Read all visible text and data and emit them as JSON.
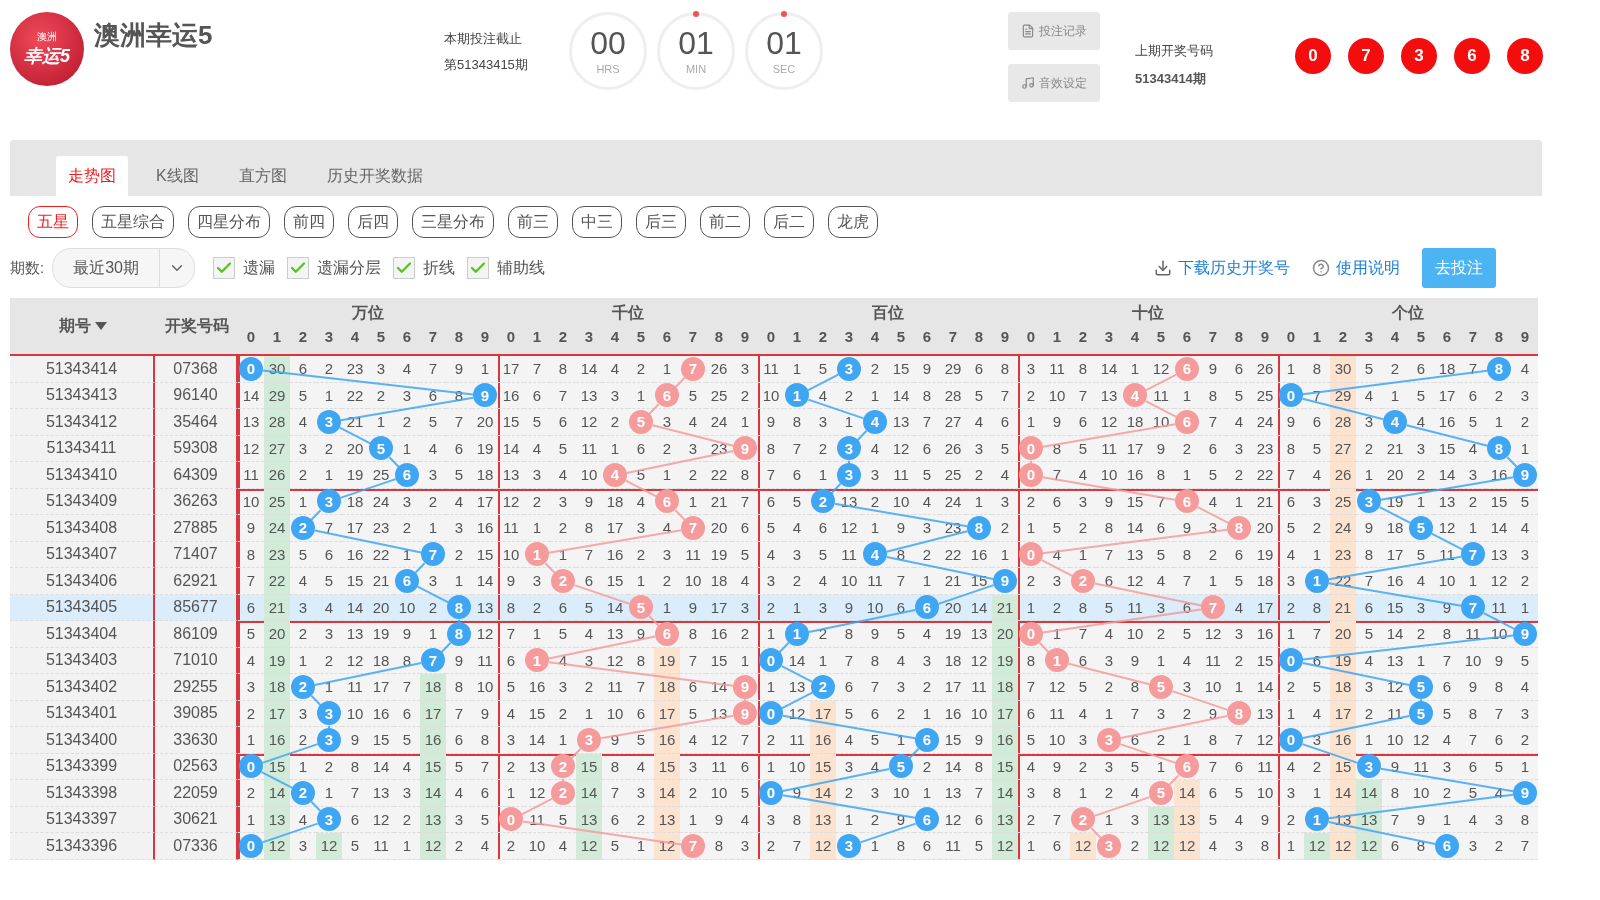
{
  "header": {
    "logo_text": [
      "澳洲",
      "幸运5"
    ],
    "title": "澳洲幸运5",
    "deadline_label": "本期投注截止",
    "deadline_period": "第51343415期",
    "countdown": [
      {
        "value": "00",
        "unit": "HRS",
        "dot": false
      },
      {
        "value": "01",
        "unit": "MIN",
        "dot": true
      },
      {
        "value": "01",
        "unit": "SEC",
        "dot": true
      }
    ],
    "buttons": [
      {
        "label": "投注记录",
        "kind": "record"
      },
      {
        "label": "音效设定",
        "kind": "sound"
      }
    ],
    "last_label": "上期开奖号码",
    "last_period": "51343414期",
    "last_balls": [
      "0",
      "7",
      "3",
      "6",
      "8"
    ]
  },
  "tabs": [
    {
      "label": "走势图",
      "selected": true
    },
    {
      "label": "K线图",
      "selected": false
    },
    {
      "label": "直方图",
      "selected": false
    },
    {
      "label": "历史开奖数据",
      "selected": false
    }
  ],
  "subtabs": [
    {
      "label": "五星",
      "selected": true
    },
    {
      "label": "五星综合",
      "selected": false
    },
    {
      "label": "四星分布",
      "selected": false
    },
    {
      "label": "前四",
      "selected": false
    },
    {
      "label": "后四",
      "selected": false
    },
    {
      "label": "三星分布",
      "selected": false
    },
    {
      "label": "前三",
      "selected": false
    },
    {
      "label": "中三",
      "selected": false
    },
    {
      "label": "后三",
      "selected": false
    },
    {
      "label": "前二",
      "selected": false
    },
    {
      "label": "后二",
      "selected": false
    },
    {
      "label": "龙虎",
      "selected": false
    }
  ],
  "filters": {
    "period_label": "期数:",
    "period_select": "最近30期",
    "options": [
      {
        "label": "遗漏",
        "checked": true
      },
      {
        "label": "遗漏分层",
        "checked": true
      },
      {
        "label": "折线",
        "checked": true
      },
      {
        "label": "辅助线",
        "checked": true
      }
    ],
    "download_link": "下载历史开奖号",
    "help_link": "使用说明",
    "bet_button": "去投注"
  },
  "table": {
    "period_header": "期号",
    "number_header": "开奖号码",
    "groups": [
      {
        "name": "万位",
        "color": "#3ea6f3",
        "digits": [
          "0",
          "1",
          "2",
          "3",
          "4",
          "5",
          "6",
          "7",
          "8",
          "9"
        ]
      },
      {
        "name": "千位",
        "color": "#f59b9b",
        "digits": [
          "0",
          "1",
          "2",
          "3",
          "4",
          "5",
          "6",
          "7",
          "8",
          "9"
        ]
      },
      {
        "name": "百位",
        "color": "#3ea6f3",
        "digits": [
          "0",
          "1",
          "2",
          "3",
          "4",
          "5",
          "6",
          "7",
          "8",
          "9"
        ]
      },
      {
        "name": "十位",
        "color": "#f59b9b",
        "digits": [
          "0",
          "1",
          "2",
          "3",
          "4",
          "5",
          "6",
          "7",
          "8",
          "9"
        ]
      },
      {
        "name": "个位",
        "color": "#3ea6f3",
        "digits": [
          "0",
          "1",
          "2",
          "3",
          "4",
          "5",
          "6",
          "7",
          "8",
          "9"
        ]
      }
    ],
    "rows": [
      {
        "period": "51343414",
        "number": "07368",
        "selected": false,
        "groups": [
          [
            {
              "ball": "0"
            },
            {
              "text": "30",
              "color": "#d2ebd8"
            },
            "6",
            "2",
            "23",
            "3",
            "4",
            "7",
            "9",
            "1"
          ],
          [
            "17",
            "7",
            "8",
            "14",
            "4",
            "2",
            "1",
            {
              "ball": "7"
            },
            "26",
            "3"
          ],
          [
            "11",
            "1",
            "5",
            {
              "ball": "3"
            },
            "2",
            "15",
            "9",
            "29",
            "6",
            "8"
          ],
          [
            "3",
            "11",
            "8",
            "14",
            "1",
            "12",
            {
              "ball": "6"
            },
            "9",
            "6",
            "26"
          ],
          [
            "1",
            "8",
            {
              "text": "30",
              "color": "#fbe3d0"
            },
            "5",
            "2",
            "6",
            "18",
            "7",
            {
              "ball": "8"
            },
            "4"
          ]
        ]
      },
      {
        "period": "51343413",
        "number": "96140",
        "selected": false,
        "groups": [
          [
            "14",
            {
              "text": "29",
              "color": "#d2ebd8"
            },
            "5",
            "1",
            "22",
            "2",
            "3",
            "6",
            "8",
            {
              "ball": "9"
            }
          ],
          [
            "16",
            "6",
            "7",
            "13",
            "3",
            "1",
            {
              "ball": "6"
            },
            "5",
            "25",
            "2"
          ],
          [
            "10",
            {
              "ball": "1"
            },
            "4",
            "2",
            "1",
            "14",
            "8",
            "28",
            "5",
            "7"
          ],
          [
            "2",
            "10",
            "7",
            "13",
            {
              "ball": "4"
            },
            "11",
            "1",
            "8",
            "5",
            "25"
          ],
          [
            {
              "ball": "0"
            },
            "7",
            {
              "text": "29",
              "color": "#fbe3d0"
            },
            "4",
            "1",
            "5",
            "17",
            "6",
            "2",
            "3"
          ]
        ]
      },
      {
        "period": "51343412",
        "number": "35464",
        "selected": false,
        "groups": [
          [
            "13",
            {
              "text": "28",
              "color": "#d2ebd8"
            },
            "4",
            {
              "ball": "3"
            },
            "21",
            "1",
            "2",
            "5",
            "7",
            "20"
          ],
          [
            "15",
            "5",
            "6",
            "12",
            "2",
            {
              "ball": "5"
            },
            "3",
            "4",
            "24",
            "1"
          ],
          [
            "9",
            "8",
            "3",
            "1",
            {
              "ball": "4"
            },
            "13",
            "7",
            "27",
            "4",
            "6"
          ],
          [
            "1",
            "9",
            "6",
            "12",
            "18",
            "10",
            {
              "ball": "6"
            },
            "7",
            "4",
            "24"
          ],
          [
            "9",
            "6",
            {
              "text": "28",
              "color": "#fbe3d0"
            },
            "3",
            {
              "ball": "4"
            },
            "4",
            "16",
            "5",
            "1",
            "2"
          ]
        ]
      },
      {
        "period": "51343411",
        "number": "59308",
        "selected": false,
        "groups": [
          [
            "12",
            {
              "text": "27",
              "color": "#d2ebd8"
            },
            "3",
            "2",
            "20",
            {
              "ball": "5"
            },
            "1",
            "4",
            "6",
            "19"
          ],
          [
            "14",
            "4",
            "5",
            "11",
            "1",
            "6",
            "2",
            "3",
            "23",
            {
              "ball": "9"
            }
          ],
          [
            "8",
            "7",
            "2",
            {
              "ball": "3"
            },
            "4",
            "12",
            "6",
            "26",
            "3",
            "5"
          ],
          [
            {
              "ball": "0"
            },
            "8",
            "5",
            "11",
            "17",
            "9",
            "2",
            "6",
            "3",
            "23"
          ],
          [
            "8",
            "5",
            {
              "text": "27",
              "color": "#fbe3d0"
            },
            "2",
            "21",
            "3",
            "15",
            "4",
            {
              "ball": "8"
            },
            "1"
          ]
        ]
      },
      {
        "period": "51343410",
        "number": "64309",
        "selected": false,
        "groups": [
          [
            "11",
            {
              "text": "26",
              "color": "#d2ebd8"
            },
            "2",
            "1",
            "19",
            "25",
            {
              "ball": "6"
            },
            "3",
            "5",
            "18"
          ],
          [
            "13",
            "3",
            "4",
            "10",
            {
              "ball": "4"
            },
            "5",
            "1",
            "2",
            "22",
            "8"
          ],
          [
            "7",
            "6",
            "1",
            {
              "ball": "3"
            },
            "3",
            "11",
            "5",
            "25",
            "2",
            "4"
          ],
          [
            {
              "ball": "0"
            },
            "7",
            "4",
            "10",
            "16",
            "8",
            "1",
            "5",
            "2",
            "22"
          ],
          [
            "7",
            "4",
            {
              "text": "26",
              "color": "#fbe3d0"
            },
            "1",
            "20",
            "2",
            "14",
            "3",
            "16",
            {
              "ball": "9"
            }
          ]
        ]
      },
      {
        "period": "51343409",
        "number": "36263",
        "selected": false,
        "groups": [
          [
            "10",
            {
              "text": "25",
              "color": "#d2ebd8"
            },
            "1",
            {
              "ball": "3"
            },
            "18",
            "24",
            "3",
            "2",
            "4",
            "17"
          ],
          [
            "12",
            "2",
            "3",
            "9",
            "18",
            "4",
            {
              "ball": "6"
            },
            "1",
            "21",
            "7"
          ],
          [
            "6",
            "5",
            {
              "ball": "2"
            },
            "13",
            "2",
            "10",
            "4",
            "24",
            "1",
            "3"
          ],
          [
            "2",
            "6",
            "3",
            "9",
            "15",
            "7",
            {
              "ball": "6"
            },
            "4",
            "1",
            "21"
          ],
          [
            "6",
            "3",
            {
              "text": "25",
              "color": "#fbe3d0"
            },
            {
              "ball": "3"
            },
            "19",
            "1",
            "13",
            "2",
            "15",
            "5"
          ]
        ]
      },
      {
        "period": "51343408",
        "number": "27885",
        "selected": false,
        "groups": [
          [
            "9",
            {
              "text": "24",
              "color": "#d2ebd8"
            },
            {
              "ball": "2"
            },
            "7",
            "17",
            "23",
            "2",
            "1",
            "3",
            "16"
          ],
          [
            "11",
            "1",
            "2",
            "8",
            "17",
            "3",
            "4",
            {
              "ball": "7"
            },
            "20",
            "6"
          ],
          [
            "5",
            "4",
            "6",
            "12",
            "1",
            "9",
            "3",
            "23",
            {
              "ball": "8"
            },
            "2"
          ],
          [
            "1",
            "5",
            "2",
            "8",
            "14",
            "6",
            "9",
            "3",
            {
              "ball": "8"
            },
            "20"
          ],
          [
            "5",
            "2",
            {
              "text": "24",
              "color": "#fbe3d0"
            },
            "9",
            "18",
            {
              "ball": "5"
            },
            "12",
            "1",
            "14",
            "4"
          ]
        ]
      },
      {
        "period": "51343407",
        "number": "71407",
        "selected": false,
        "groups": [
          [
            "8",
            {
              "text": "23",
              "color": "#d2ebd8"
            },
            "5",
            "6",
            "16",
            "22",
            "1",
            {
              "ball": "7"
            },
            "2",
            "15"
          ],
          [
            "10",
            {
              "ball": "1"
            },
            "1",
            "7",
            "16",
            "2",
            "3",
            "11",
            "19",
            "5"
          ],
          [
            "4",
            "3",
            "5",
            "11",
            {
              "ball": "4"
            },
            "8",
            "2",
            "22",
            "16",
            "1"
          ],
          [
            {
              "ball": "0"
            },
            "4",
            "1",
            "7",
            "13",
            "5",
            "8",
            "2",
            "6",
            "19"
          ],
          [
            "4",
            "1",
            {
              "text": "23",
              "color": "#fbe3d0"
            },
            "8",
            "17",
            "5",
            "11",
            {
              "ball": "7"
            },
            "13",
            "3"
          ]
        ]
      },
      {
        "period": "51343406",
        "number": "62921",
        "selected": false,
        "groups": [
          [
            "7",
            {
              "text": "22",
              "color": "#d2ebd8"
            },
            "4",
            "5",
            "15",
            "21",
            {
              "ball": "6"
            },
            "3",
            "1",
            "14"
          ],
          [
            "9",
            "3",
            {
              "ball": "2"
            },
            "6",
            "15",
            "1",
            "2",
            "10",
            "18",
            "4"
          ],
          [
            "3",
            "2",
            "4",
            "10",
            "11",
            "7",
            "1",
            "21",
            "15",
            {
              "ball": "9"
            }
          ],
          [
            "2",
            "3",
            {
              "ball": "2"
            },
            "6",
            "12",
            "4",
            "7",
            "1",
            "5",
            "18"
          ],
          [
            "3",
            {
              "ball": "1"
            },
            {
              "text": "22",
              "color": "#fbe3d0"
            },
            "7",
            "16",
            "4",
            "10",
            "1",
            "12",
            "2"
          ]
        ]
      },
      {
        "period": "51343405",
        "number": "85677",
        "selected": true,
        "groups": [
          [
            "6",
            {
              "text": "21",
              "color": "#d2ebd8"
            },
            "3",
            "4",
            "14",
            "20",
            "10",
            "2",
            {
              "ball": "8"
            },
            "13"
          ],
          [
            "8",
            "2",
            "6",
            "5",
            "14",
            {
              "ball": "5"
            },
            "1",
            "9",
            "17",
            "3"
          ],
          [
            "2",
            "1",
            "3",
            "9",
            "10",
            "6",
            {
              "ball": "6"
            },
            "20",
            "14",
            {
              "text": "21",
              "color": "#d2ebd8"
            }
          ],
          [
            "1",
            "2",
            "8",
            "5",
            "11",
            "3",
            "6",
            {
              "ball": "7"
            },
            "4",
            "17"
          ],
          [
            "2",
            "8",
            {
              "text": "21",
              "color": "#fbe3d0"
            },
            "6",
            "15",
            "3",
            "9",
            {
              "ball": "7"
            },
            "11",
            "1"
          ]
        ]
      },
      {
        "period": "51343404",
        "number": "86109",
        "selected": false,
        "groups": [
          [
            "5",
            {
              "text": "20",
              "color": "#d2ebd8"
            },
            "2",
            "3",
            "13",
            "19",
            "9",
            "1",
            {
              "ball": "8"
            },
            "12"
          ],
          [
            "7",
            "1",
            "5",
            "4",
            "13",
            "9",
            {
              "ball": "6"
            },
            "8",
            "16",
            "2"
          ],
          [
            "1",
            {
              "ball": "1"
            },
            "2",
            "8",
            "9",
            "5",
            "4",
            "19",
            "13",
            {
              "text": "20",
              "color": "#d2ebd8"
            }
          ],
          [
            {
              "ball": "0"
            },
            "1",
            "7",
            "4",
            "10",
            "2",
            "5",
            "12",
            "3",
            "16"
          ],
          [
            "1",
            "7",
            {
              "text": "20",
              "color": "#fbe3d0"
            },
            "5",
            "14",
            "2",
            "8",
            "11",
            "10",
            {
              "ball": "9"
            }
          ]
        ]
      },
      {
        "period": "51343403",
        "number": "71010",
        "selected": false,
        "groups": [
          [
            "4",
            {
              "text": "19",
              "color": "#d2ebd8"
            },
            "1",
            "2",
            "12",
            "18",
            "8",
            {
              "ball": "7"
            },
            "9",
            "11"
          ],
          [
            "6",
            {
              "ball": "1"
            },
            "4",
            "3",
            "12",
            "8",
            {
              "text": "19",
              "color": "#fbe3d0"
            },
            "7",
            "15",
            "1"
          ],
          [
            {
              "ball": "0"
            },
            "14",
            "1",
            "7",
            "8",
            "4",
            "3",
            "18",
            "12",
            {
              "text": "19",
              "color": "#d2ebd8"
            }
          ],
          [
            "8",
            {
              "ball": "1"
            },
            "6",
            "3",
            "9",
            "1",
            "4",
            "11",
            "2",
            "15"
          ],
          [
            {
              "ball": "0"
            },
            "6",
            {
              "text": "19",
              "color": "#fbe3d0"
            },
            "4",
            "13",
            "1",
            "7",
            "10",
            "9",
            "5"
          ]
        ]
      },
      {
        "period": "51343402",
        "number": "29255",
        "selected": false,
        "groups": [
          [
            "3",
            {
              "text": "18",
              "color": "#d2ebd8"
            },
            {
              "ball": "2"
            },
            "1",
            "11",
            "17",
            "7",
            {
              "text": "18",
              "color": "#d2ebd8"
            },
            "8",
            "10"
          ],
          [
            "5",
            "16",
            "3",
            "2",
            "11",
            "7",
            {
              "text": "18",
              "color": "#fbe3d0"
            },
            "6",
            "14",
            {
              "ball": "9"
            }
          ],
          [
            "1",
            "13",
            {
              "ball": "2"
            },
            "6",
            "7",
            "3",
            "2",
            "17",
            "11",
            {
              "text": "18",
              "color": "#d2ebd8"
            }
          ],
          [
            "7",
            "12",
            "5",
            "2",
            "8",
            {
              "ball": "5"
            },
            "3",
            "10",
            "1",
            "14"
          ],
          [
            "2",
            "5",
            {
              "text": "18",
              "color": "#fbe3d0"
            },
            "3",
            "12",
            {
              "ball": "5"
            },
            "6",
            "9",
            "8",
            "4"
          ]
        ]
      },
      {
        "period": "51343401",
        "number": "39085",
        "selected": false,
        "groups": [
          [
            "2",
            {
              "text": "17",
              "color": "#d2ebd8"
            },
            "3",
            {
              "ball": "3"
            },
            "10",
            "16",
            "6",
            {
              "text": "17",
              "color": "#d2ebd8"
            },
            "7",
            "9"
          ],
          [
            "4",
            "15",
            "2",
            "1",
            "10",
            "6",
            {
              "text": "17",
              "color": "#fbe3d0"
            },
            "5",
            "13",
            {
              "ball": "9"
            }
          ],
          [
            {
              "ball": "0"
            },
            "12",
            {
              "text": "17",
              "color": "#fbe3d0"
            },
            "5",
            "6",
            "2",
            "1",
            "16",
            "10",
            {
              "text": "17",
              "color": "#d2ebd8"
            }
          ],
          [
            "6",
            "11",
            "4",
            "1",
            "7",
            "3",
            "2",
            "9",
            {
              "ball": "8"
            },
            "13"
          ],
          [
            "1",
            "4",
            {
              "text": "17",
              "color": "#fbe3d0"
            },
            "2",
            "11",
            {
              "ball": "5"
            },
            "5",
            "8",
            "7",
            "3"
          ]
        ]
      },
      {
        "period": "51343400",
        "number": "33630",
        "selected": false,
        "groups": [
          [
            "1",
            {
              "text": "16",
              "color": "#d2ebd8"
            },
            "2",
            {
              "ball": "3"
            },
            "9",
            "15",
            "5",
            {
              "text": "16",
              "color": "#d2ebd8"
            },
            "6",
            "8"
          ],
          [
            "3",
            "14",
            "1",
            {
              "ball": "3"
            },
            "9",
            "5",
            {
              "text": "16",
              "color": "#fbe3d0"
            },
            "4",
            "12",
            "7"
          ],
          [
            "2",
            "11",
            {
              "text": "16",
              "color": "#fbe3d0"
            },
            "4",
            "5",
            "1",
            {
              "ball": "6"
            },
            "15",
            "9",
            {
              "text": "16",
              "color": "#d2ebd8"
            }
          ],
          [
            "5",
            "10",
            "3",
            {
              "ball": "3"
            },
            "6",
            "2",
            "1",
            "8",
            "7",
            "12"
          ],
          [
            {
              "ball": "0"
            },
            "3",
            {
              "text": "16",
              "color": "#fbe3d0"
            },
            "1",
            "10",
            "12",
            "4",
            "7",
            "6",
            "2"
          ]
        ]
      },
      {
        "period": "51343399",
        "number": "02563",
        "selected": false,
        "groups": [
          [
            {
              "ball": "0"
            },
            {
              "text": "15",
              "color": "#d2ebd8"
            },
            "1",
            "2",
            "8",
            "14",
            "4",
            {
              "text": "15",
              "color": "#d2ebd8"
            },
            "5",
            "7"
          ],
          [
            "2",
            "13",
            {
              "ball": "2"
            },
            {
              "text": "15",
              "color": "#d2ebd8"
            },
            "8",
            "4",
            {
              "text": "15",
              "color": "#fbe3d0"
            },
            "3",
            "11",
            "6"
          ],
          [
            "1",
            "10",
            {
              "text": "15",
              "color": "#fbe3d0"
            },
            "3",
            "4",
            {
              "ball": "5"
            },
            "2",
            "14",
            "8",
            {
              "text": "15",
              "color": "#d2ebd8"
            }
          ],
          [
            "4",
            "9",
            "2",
            "3",
            "5",
            "1",
            {
              "ball": "6"
            },
            "7",
            "6",
            "11"
          ],
          [
            "4",
            "2",
            {
              "text": "15",
              "color": "#fbe3d0"
            },
            {
              "ball": "3"
            },
            "9",
            "11",
            "3",
            "6",
            "5",
            "1"
          ]
        ]
      },
      {
        "period": "51343398",
        "number": "22059",
        "selected": false,
        "groups": [
          [
            "2",
            {
              "text": "14",
              "color": "#d2ebd8"
            },
            {
              "ball": "2"
            },
            "1",
            "7",
            "13",
            "3",
            {
              "text": "14",
              "color": "#d2ebd8"
            },
            "4",
            "6"
          ],
          [
            "1",
            "12",
            {
              "ball": "2"
            },
            {
              "text": "14",
              "color": "#d2ebd8"
            },
            "7",
            "3",
            {
              "text": "14",
              "color": "#fbe3d0"
            },
            "2",
            "10",
            "5"
          ],
          [
            {
              "ball": "0"
            },
            "9",
            {
              "text": "14",
              "color": "#fbe3d0"
            },
            "2",
            "3",
            "10",
            "1",
            "13",
            "7",
            {
              "text": "14",
              "color": "#d2ebd8"
            }
          ],
          [
            "3",
            "8",
            "1",
            "2",
            "4",
            {
              "ball": "5"
            },
            {
              "text": "14",
              "color": "#fbe3d0"
            },
            "6",
            "5",
            "10"
          ],
          [
            "3",
            "1",
            {
              "text": "14",
              "color": "#fbe3d0"
            },
            {
              "text": "14",
              "color": "#d2ebd8"
            },
            "8",
            "10",
            "2",
            "5",
            "4",
            {
              "ball": "9"
            }
          ]
        ]
      },
      {
        "period": "51343397",
        "number": "30621",
        "selected": false,
        "groups": [
          [
            "1",
            {
              "text": "13",
              "color": "#d2ebd8"
            },
            "4",
            {
              "ball": "3"
            },
            "6",
            "12",
            "2",
            {
              "text": "13",
              "color": "#d2ebd8"
            },
            "3",
            "5"
          ],
          [
            {
              "ball": "0"
            },
            "11",
            "5",
            {
              "text": "13",
              "color": "#d2ebd8"
            },
            "6",
            "2",
            {
              "text": "13",
              "color": "#fbe3d0"
            },
            "1",
            "9",
            "4"
          ],
          [
            "3",
            "8",
            {
              "text": "13",
              "color": "#fbe3d0"
            },
            "1",
            "2",
            "9",
            {
              "ball": "6"
            },
            "12",
            "6",
            {
              "text": "13",
              "color": "#d2ebd8"
            }
          ],
          [
            "2",
            "7",
            {
              "ball": "2"
            },
            "1",
            "3",
            {
              "text": "13",
              "color": "#d2ebd8"
            },
            {
              "text": "13",
              "color": "#fbe3d0"
            },
            "5",
            "4",
            "9"
          ],
          [
            "2",
            {
              "ball": "1"
            },
            {
              "text": "13",
              "color": "#fbe3d0"
            },
            {
              "text": "13",
              "color": "#d2ebd8"
            },
            "7",
            "9",
            "1",
            "4",
            "3",
            "8"
          ]
        ]
      },
      {
        "period": "51343396",
        "number": "07336",
        "selected": false,
        "groups": [
          [
            {
              "ball": "0"
            },
            {
              "text": "12",
              "color": "#d2ebd8"
            },
            "3",
            {
              "text": "12",
              "color": "#d2ebd8"
            },
            "5",
            "11",
            "1",
            {
              "text": "12",
              "color": "#d2ebd8"
            },
            "2",
            "4"
          ],
          [
            "2",
            "10",
            "4",
            {
              "text": "12",
              "color": "#d2ebd8"
            },
            "5",
            "1",
            {
              "text": "12",
              "color": "#fbe3d0"
            },
            {
              "ball": "7"
            },
            "8",
            "3"
          ],
          [
            "2",
            "7",
            {
              "text": "12",
              "color": "#fbe3d0"
            },
            {
              "ball": "3"
            },
            "1",
            "8",
            "6",
            "11",
            "5",
            {
              "text": "12",
              "color": "#d2ebd8"
            }
          ],
          [
            "1",
            "6",
            {
              "text": "12",
              "color": "#fbe3d0"
            },
            {
              "ball": "3"
            },
            "2",
            {
              "text": "12",
              "color": "#d2ebd8"
            },
            {
              "text": "12",
              "color": "#fbe3d0"
            },
            "4",
            "3",
            "8"
          ],
          [
            "1",
            {
              "text": "12",
              "color": "#d2ebd8"
            },
            {
              "text": "12",
              "color": "#fbe3d0"
            },
            {
              "text": "12",
              "color": "#d2ebd8"
            },
            "6",
            "8",
            {
              "ball": "6"
            },
            "3",
            "2",
            "7"
          ]
        ]
      }
    ]
  }
}
